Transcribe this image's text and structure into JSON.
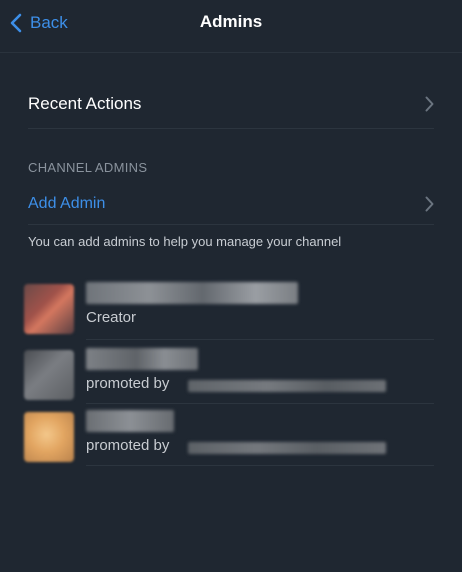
{
  "nav": {
    "back_label": "Back",
    "title": "Admins"
  },
  "recent": {
    "label": "Recent Actions"
  },
  "section": {
    "header": "CHANNEL ADMINS",
    "add_label": "Add Admin",
    "hint": "You can add admins to help you manage your channel"
  },
  "admins": [
    {
      "subtitle": "Creator"
    },
    {
      "subtitle": "promoted by"
    },
    {
      "subtitle": "promoted by"
    }
  ],
  "colors": {
    "background": "#1f2731",
    "accent": "#3d8fe8",
    "secondary_text": "#8a939d"
  },
  "icons": {
    "back": "chevron-left-icon",
    "row_chevron": "chevron-right-icon"
  }
}
